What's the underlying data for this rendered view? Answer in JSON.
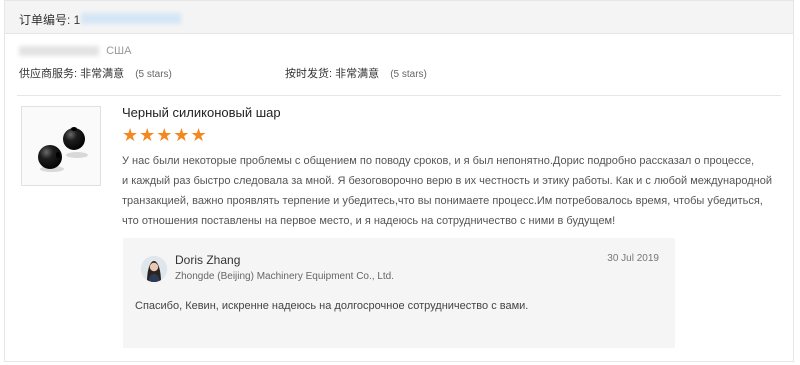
{
  "order": {
    "label": "订单编号: 1"
  },
  "buyer": {
    "country": "США"
  },
  "ratings": [
    {
      "label": "供应商服务:",
      "value": "非常满意",
      "note": "(5 stars)"
    },
    {
      "label": "按时发货:",
      "value": "非常满意",
      "note": "(5 stars)"
    }
  ],
  "product": {
    "title": "Черный силиконовый шар"
  },
  "stars": {
    "display": "★★★★★",
    "rating": 5,
    "color": "#f5871f"
  },
  "review": {
    "lines": [
      "У нас были некоторые проблемы с общением по поводу сроков, и я был непонятно.Дорис подробно рассказал о процессе,",
      "и каждый раз быстро следовала за мной. Я безоговорочно верю в их честность и этику работы. Как и с любой международной",
      "транзакцией, важно проявлять терпение и убедитесь,что вы понимаете процесс.Им потребовалось время, чтобы убедиться,",
      "что отношения поставлены на первое место, и я надеюсь на сотрудничество с ними в будущем!"
    ]
  },
  "reply": {
    "name": "Doris Zhang",
    "company": "Zhongde (Beijing) Machinery Equipment Co., Ltd.",
    "date": "30 Jul 2019",
    "text": "Спасибо, Кевин, искренне надеюсь на долгосрочное сотрудничество с вами."
  }
}
